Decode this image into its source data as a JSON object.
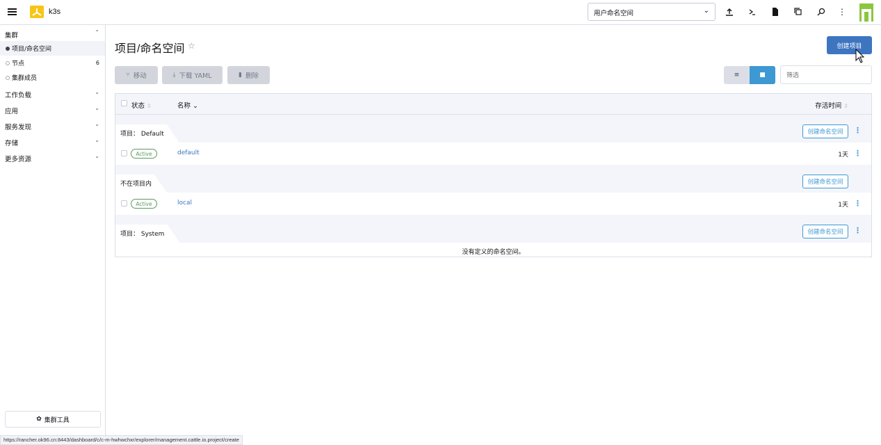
{
  "header": {
    "cluster_name": "k3s",
    "namespace_filter": "用户命名空间"
  },
  "sidebar": {
    "cluster_group": "集群",
    "cluster_items": [
      {
        "label": "项目/命名空间",
        "count": ""
      },
      {
        "label": "节点",
        "count": "6"
      },
      {
        "label": "集群成员",
        "count": ""
      }
    ],
    "groups": [
      "工作负载",
      "应用",
      "服务发现",
      "存储",
      "更多资源"
    ],
    "cluster_tools": "集群工具"
  },
  "main": {
    "title": "项目/命名空间",
    "create_project": "创建项目",
    "actions": {
      "move": "移动",
      "download": "下载 YAML",
      "delete": "删除"
    },
    "filter_placeholder": "筛选",
    "columns": {
      "state": "状态",
      "name": "名称",
      "age": "存活时间"
    },
    "groups": [
      {
        "label": "项目： Default",
        "create_ns": "创建命名空间",
        "rows": [
          {
            "state": "Active",
            "name": "default",
            "age": "1天"
          }
        ]
      },
      {
        "label": "不在项目内",
        "create_ns": "创建命名空间",
        "rows": [
          {
            "state": "Active",
            "name": "local",
            "age": "1天"
          }
        ]
      },
      {
        "label": "项目： System",
        "create_ns": "创建命名空间",
        "empty": "没有定义的命名空间。"
      }
    ]
  },
  "status_url": "https://rancher.ok96.cn:8443/dashboard/c/c-m-hwhwchxr/explorer/management.cattle.io.project/create",
  "colors": {
    "primary": "#3d75c0",
    "link": "#3d98d3",
    "active_badge": "#5d995d",
    "logo": "#f7c515",
    "avatar": "#8cc63f"
  }
}
